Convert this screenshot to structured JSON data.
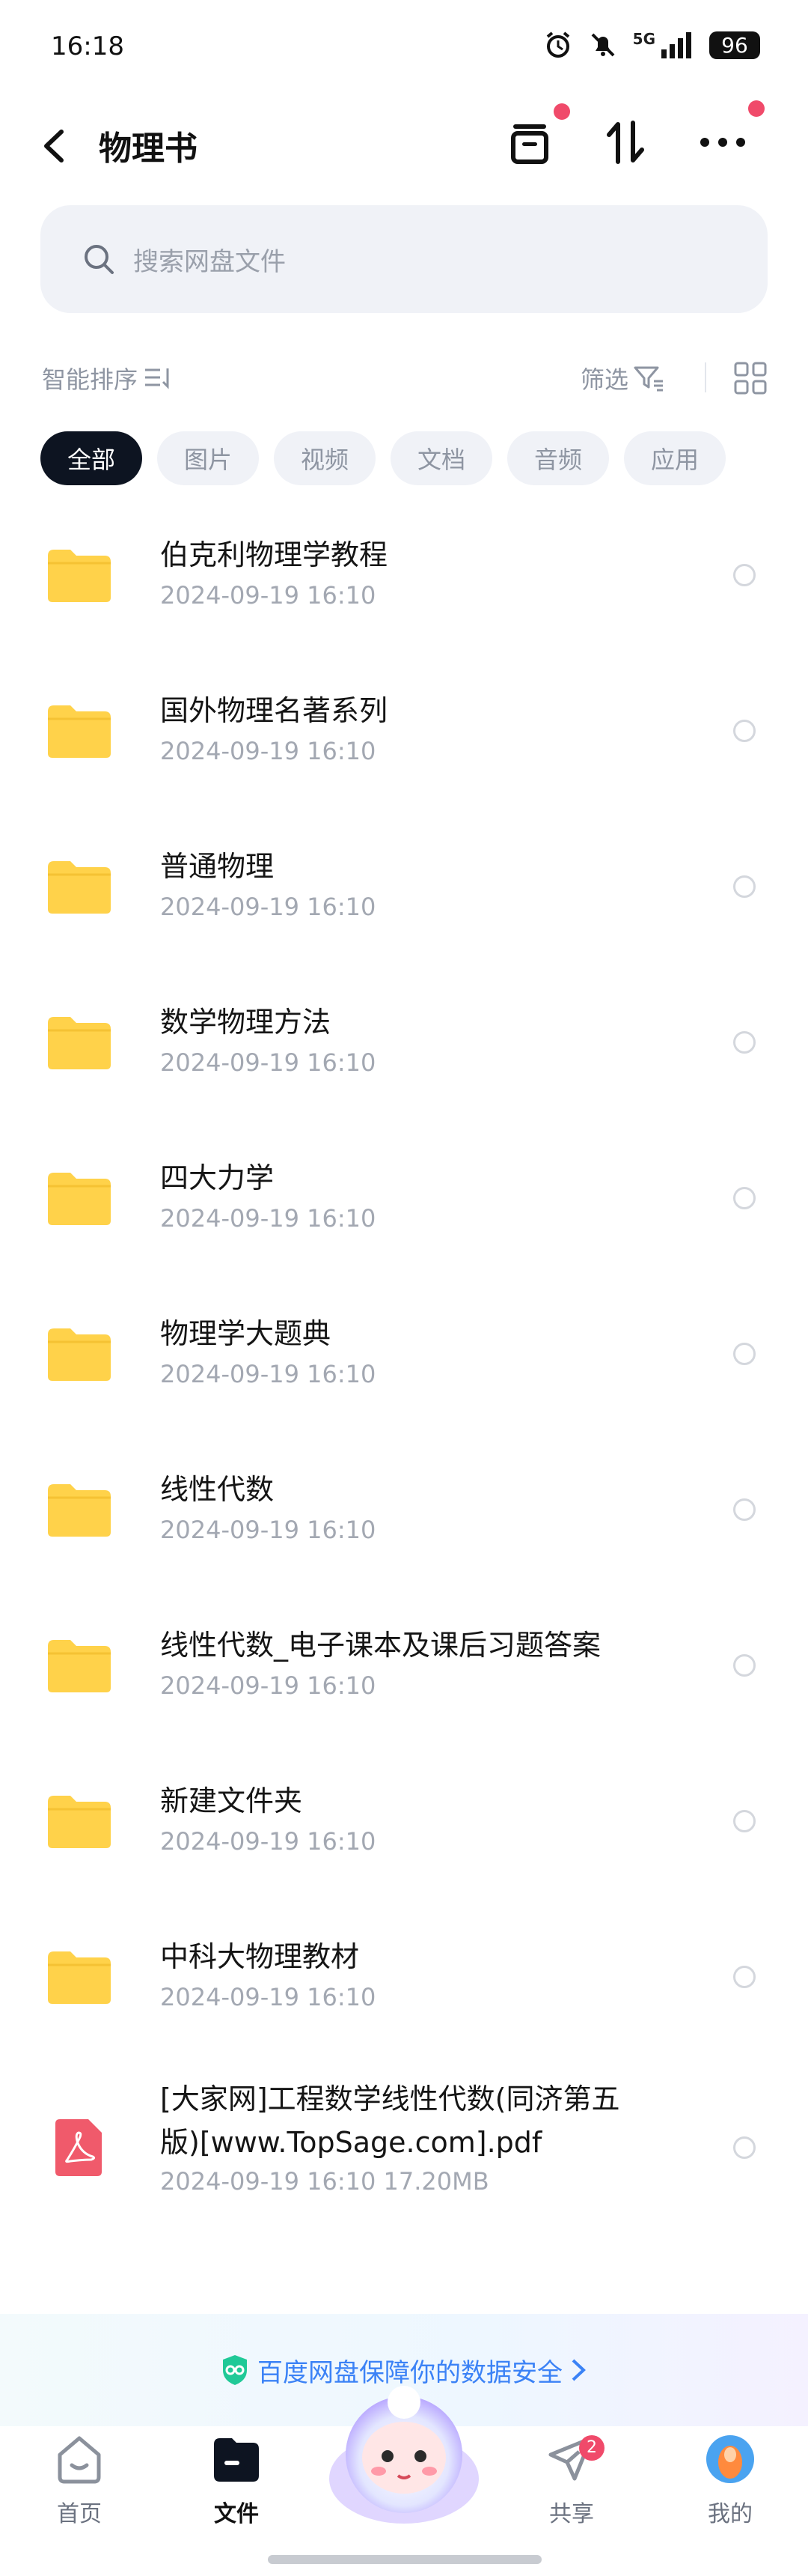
{
  "status_bar": {
    "time": "16:18",
    "network": "5G",
    "battery": "96"
  },
  "header": {
    "title": "物理书",
    "icons": [
      "back-icon",
      "archive-icon",
      "sort-arrows-icon",
      "more-icon"
    ]
  },
  "search": {
    "placeholder": "搜索网盘文件"
  },
  "toolbar": {
    "sort_label": "智能排序",
    "filter_label": "筛选"
  },
  "filter_chips": [
    {
      "label": "全部",
      "active": true
    },
    {
      "label": "图片",
      "active": false
    },
    {
      "label": "视频",
      "active": false
    },
    {
      "label": "文档",
      "active": false
    },
    {
      "label": "音频",
      "active": false
    },
    {
      "label": "应用",
      "active": false
    }
  ],
  "files": [
    {
      "name": "伯克利物理学教程",
      "meta": "2024-09-19  16:10",
      "type": "folder"
    },
    {
      "name": "国外物理名著系列",
      "meta": "2024-09-19  16:10",
      "type": "folder"
    },
    {
      "name": "普通物理",
      "meta": "2024-09-19  16:10",
      "type": "folder"
    },
    {
      "name": "数学物理方法",
      "meta": "2024-09-19  16:10",
      "type": "folder"
    },
    {
      "name": "四大力学",
      "meta": "2024-09-19  16:10",
      "type": "folder"
    },
    {
      "name": "物理学大题典",
      "meta": "2024-09-19  16:10",
      "type": "folder"
    },
    {
      "name": "线性代数",
      "meta": "2024-09-19  16:10",
      "type": "folder"
    },
    {
      "name": "线性代数_电子课本及课后习题答案",
      "meta": "2024-09-19  16:10",
      "type": "folder"
    },
    {
      "name": "新建文件夹",
      "meta": "2024-09-19  16:10",
      "type": "folder"
    },
    {
      "name": "中科大物理教材",
      "meta": "2024-09-19  16:10",
      "type": "folder"
    },
    {
      "name_line1": "[大家网]工程数学线性代数(同济第五",
      "name_line2": "版)[www.TopSage.com].pdf",
      "meta": "2024-09-19  16:10   17.20MB",
      "type": "pdf"
    }
  ],
  "banner": {
    "text": "百度网盘保障你的数据安全"
  },
  "bottom_nav": {
    "items": [
      {
        "label": "首页",
        "icon": "home-icon"
      },
      {
        "label": "文件",
        "icon": "files-icon",
        "active": true
      },
      {
        "label": "共享",
        "icon": "share-icon",
        "badge": "2"
      },
      {
        "label": "我的",
        "icon": "avatar-icon"
      }
    ]
  },
  "colors": {
    "accent_dark": "#0d1421",
    "folder_yellow": "#ffd24a",
    "pdf_red": "#f05a6b",
    "badge_red": "#f04a6a",
    "link_blue": "#3b82f6"
  }
}
